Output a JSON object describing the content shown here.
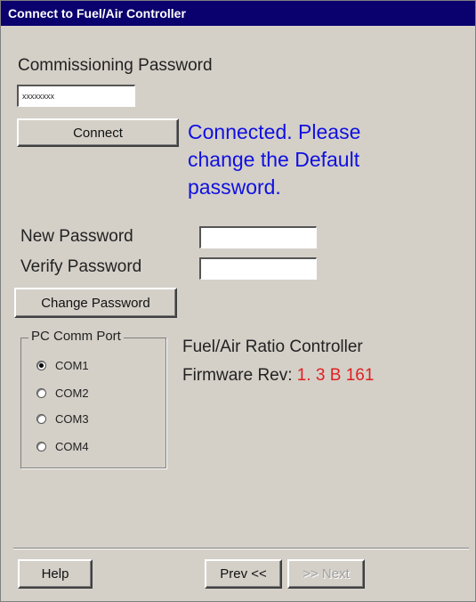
{
  "window": {
    "title": "Connect to Fuel/Air Controller"
  },
  "commissioning": {
    "label": "Commissioning Password",
    "value": "xxxxxxxx",
    "connect_label": "Connect"
  },
  "status": {
    "line1": "Connected.  Please",
    "line2": "change the Default",
    "line3": "password.",
    "color": "#1010e0"
  },
  "change_password": {
    "new_label": "New Password",
    "new_value": "",
    "verify_label": "Verify Password",
    "verify_value": "",
    "button_label": "Change Password"
  },
  "comm_port": {
    "legend": "PC Comm Port",
    "options": [
      {
        "label": "COM1",
        "selected": true
      },
      {
        "label": "COM2",
        "selected": false
      },
      {
        "label": "COM3",
        "selected": false
      },
      {
        "label": "COM4",
        "selected": false
      }
    ]
  },
  "controller": {
    "name": "Fuel/Air Ratio Controller",
    "firmware_label": "Firmware Rev:",
    "firmware_value": "1. 3  B 161",
    "firmware_color": "#e02020"
  },
  "footer": {
    "help_label": "Help",
    "prev_label": "Prev <<",
    "next_label": ">> Next",
    "next_enabled": false
  }
}
